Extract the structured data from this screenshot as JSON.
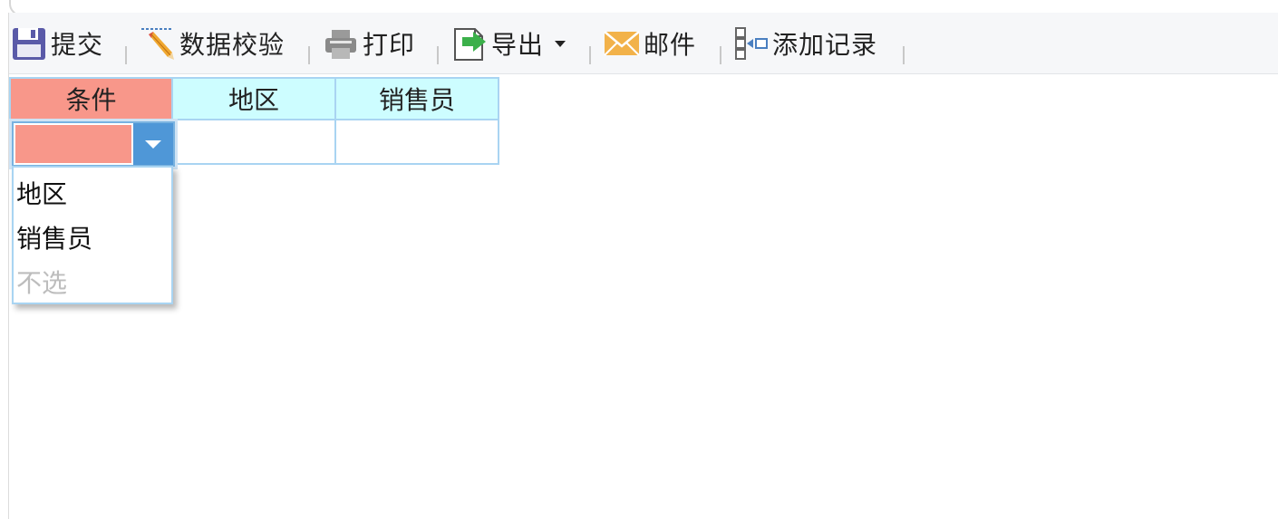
{
  "toolbar": {
    "items": [
      {
        "label": "提交",
        "icon": "save-icon"
      },
      {
        "label": "数据校验",
        "icon": "validate-pencil-icon"
      },
      {
        "label": "打印",
        "icon": "printer-icon"
      },
      {
        "label": "导出",
        "icon": "export-icon"
      },
      {
        "label": "邮件",
        "icon": "mail-icon"
      },
      {
        "label": "添加记录",
        "icon": "add-record-icon"
      }
    ]
  },
  "table": {
    "headers": [
      "条件",
      "地区",
      "销售员"
    ],
    "row": [
      "",
      "",
      ""
    ]
  },
  "condition_select": {
    "value": "",
    "options": [
      "地区",
      "销售员"
    ],
    "none_option": "不选"
  },
  "colors": {
    "condition_header": "#f8978a",
    "header_cyan": "#cdfdff",
    "border_blue": "#a9d4f2",
    "select_button": "#4f97d7"
  }
}
